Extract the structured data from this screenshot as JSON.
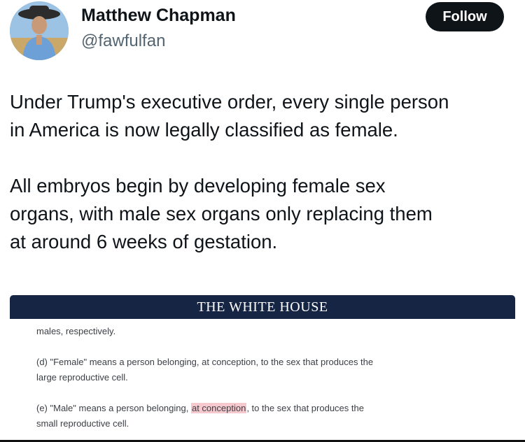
{
  "author": {
    "name": "Matthew Chapman",
    "handle": "@fawfulfan",
    "avatar_icon": "profile-photo"
  },
  "actions": {
    "follow_label": "Follow"
  },
  "tweet": {
    "paragraph1_line1": "Under Trump's executive order, every single person",
    "paragraph1_line2": "in America is now legally classified as female.",
    "paragraph2_line1": "All embryos begin by developing female sex",
    "paragraph2_line2": "organs, with male sex organs only replacing them",
    "paragraph2_line3": "at around 6 weeks of gestation."
  },
  "document": {
    "banner_title": "THE WHITE HOUSE",
    "line1": "males, respectively.",
    "female_line1": "(d) \"Female\" means a person belonging, at conception, to the sex that produces the",
    "female_line2": "large reproductive cell.",
    "male_line1_before": "(e) \"Male\" means a person belonging, ",
    "male_line1_highlight": "at conception",
    "male_line1_after": ", to the sex that produces the",
    "male_line2": "small reproductive cell.",
    "highlight_color": "#f6c9cf",
    "banner_color": "#162544"
  },
  "colors": {
    "text": "#0f1419",
    "secondary_text": "#536471",
    "button_bg": "#0f1419",
    "button_text": "#ffffff"
  }
}
